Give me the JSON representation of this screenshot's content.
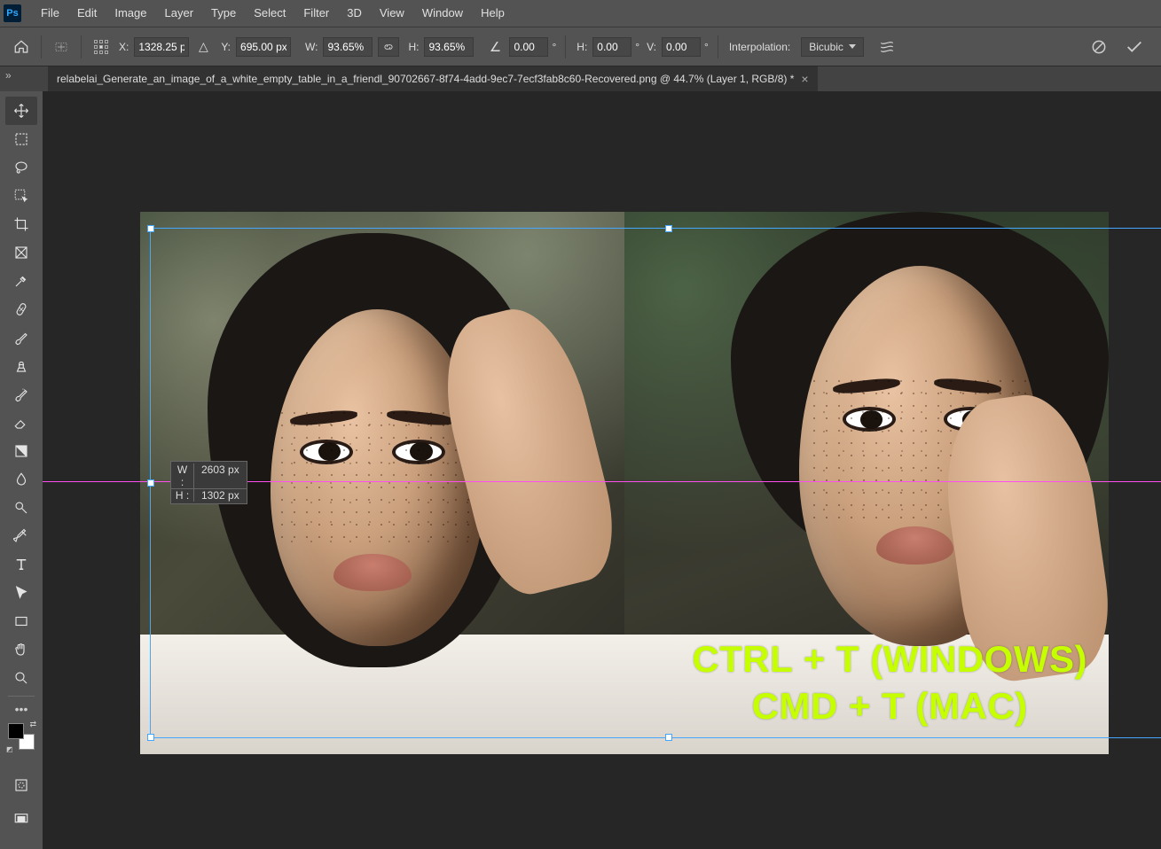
{
  "menubar": {
    "items": [
      "File",
      "Edit",
      "Image",
      "Layer",
      "Type",
      "Select",
      "Filter",
      "3D",
      "View",
      "Window",
      "Help"
    ]
  },
  "options": {
    "x_label": "X:",
    "x_value": "1328.25 p",
    "y_label": "Y:",
    "y_value": "695.00 px",
    "w_label": "W:",
    "w_value": "93.65%",
    "h_label": "H:",
    "h_value": "93.65%",
    "rotate_value": "0.00",
    "skew_h_label": "H:",
    "skew_h_value": "0.00",
    "skew_v_label": "V:",
    "skew_v_value": "0.00",
    "interp_label": "Interpolation:",
    "interp_value": "Bicubic"
  },
  "tab": {
    "title": "relabelai_Generate_an_image_of_a_white_empty_table_in_a_friendl_90702667-8f74-4add-9ec7-7ecf3fab8c60-Recovered.png @ 44.7% (Layer 1, RGB/8) *"
  },
  "readout": {
    "w_label": "W :",
    "w_value": "2603 px",
    "h_label": "H :",
    "h_value": "1302 px"
  },
  "overlay": {
    "line1": "CTRL + T (WINDOWS)",
    "line2": "CMD + T (MAC)"
  }
}
